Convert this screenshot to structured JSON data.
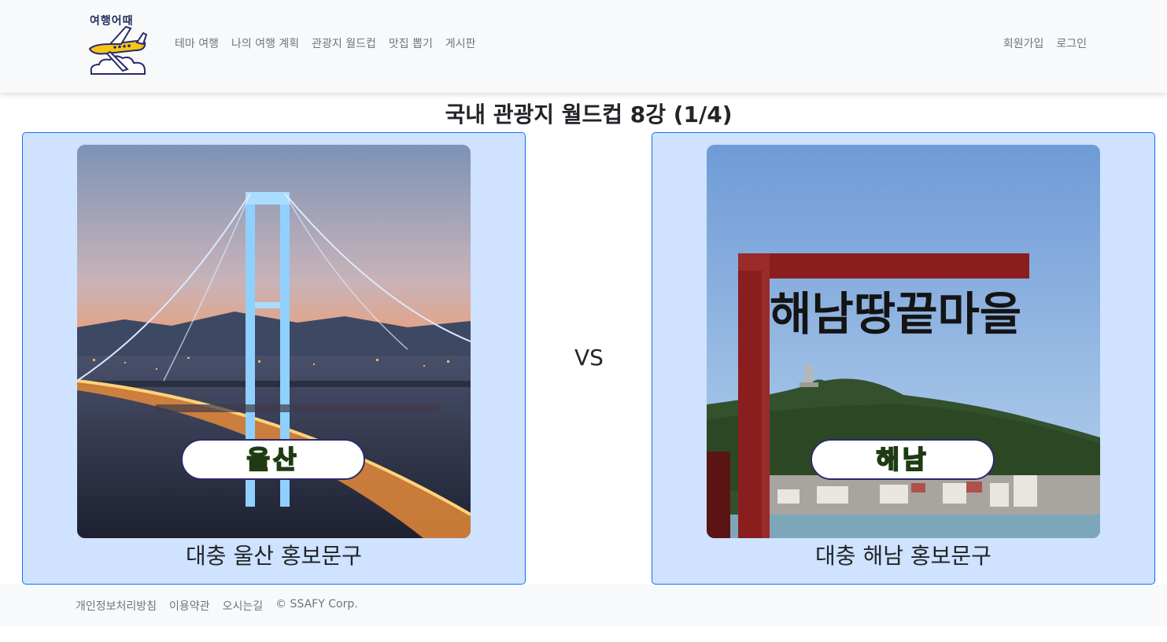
{
  "navbar": {
    "logo_text": "여행어때",
    "links": [
      "테마 여행",
      "나의 여행 계획",
      "관광지 월드컵",
      "맛집 뽑기",
      "게시판"
    ],
    "auth_links": [
      "회원가입",
      "로그인"
    ]
  },
  "main": {
    "title": "국내 관광지 월드컵 8강 (1/4)",
    "vs_label": "VS",
    "candidates": [
      {
        "name": "울산",
        "caption": "대충 울산 홍보문구"
      },
      {
        "name": "해남",
        "caption": "대충 해남 홍보문구"
      }
    ],
    "sign_text": "해남땅끝마을"
  },
  "footer": {
    "links": [
      "개인정보처리방침",
      "이용약관",
      "오시는길",
      "© SSAFY Corp."
    ]
  },
  "colors": {
    "card_bg": "#cfe2ff",
    "card_border": "#0d6efd",
    "navbar_bg": "#f8f9fa",
    "link": "#6c757d"
  }
}
